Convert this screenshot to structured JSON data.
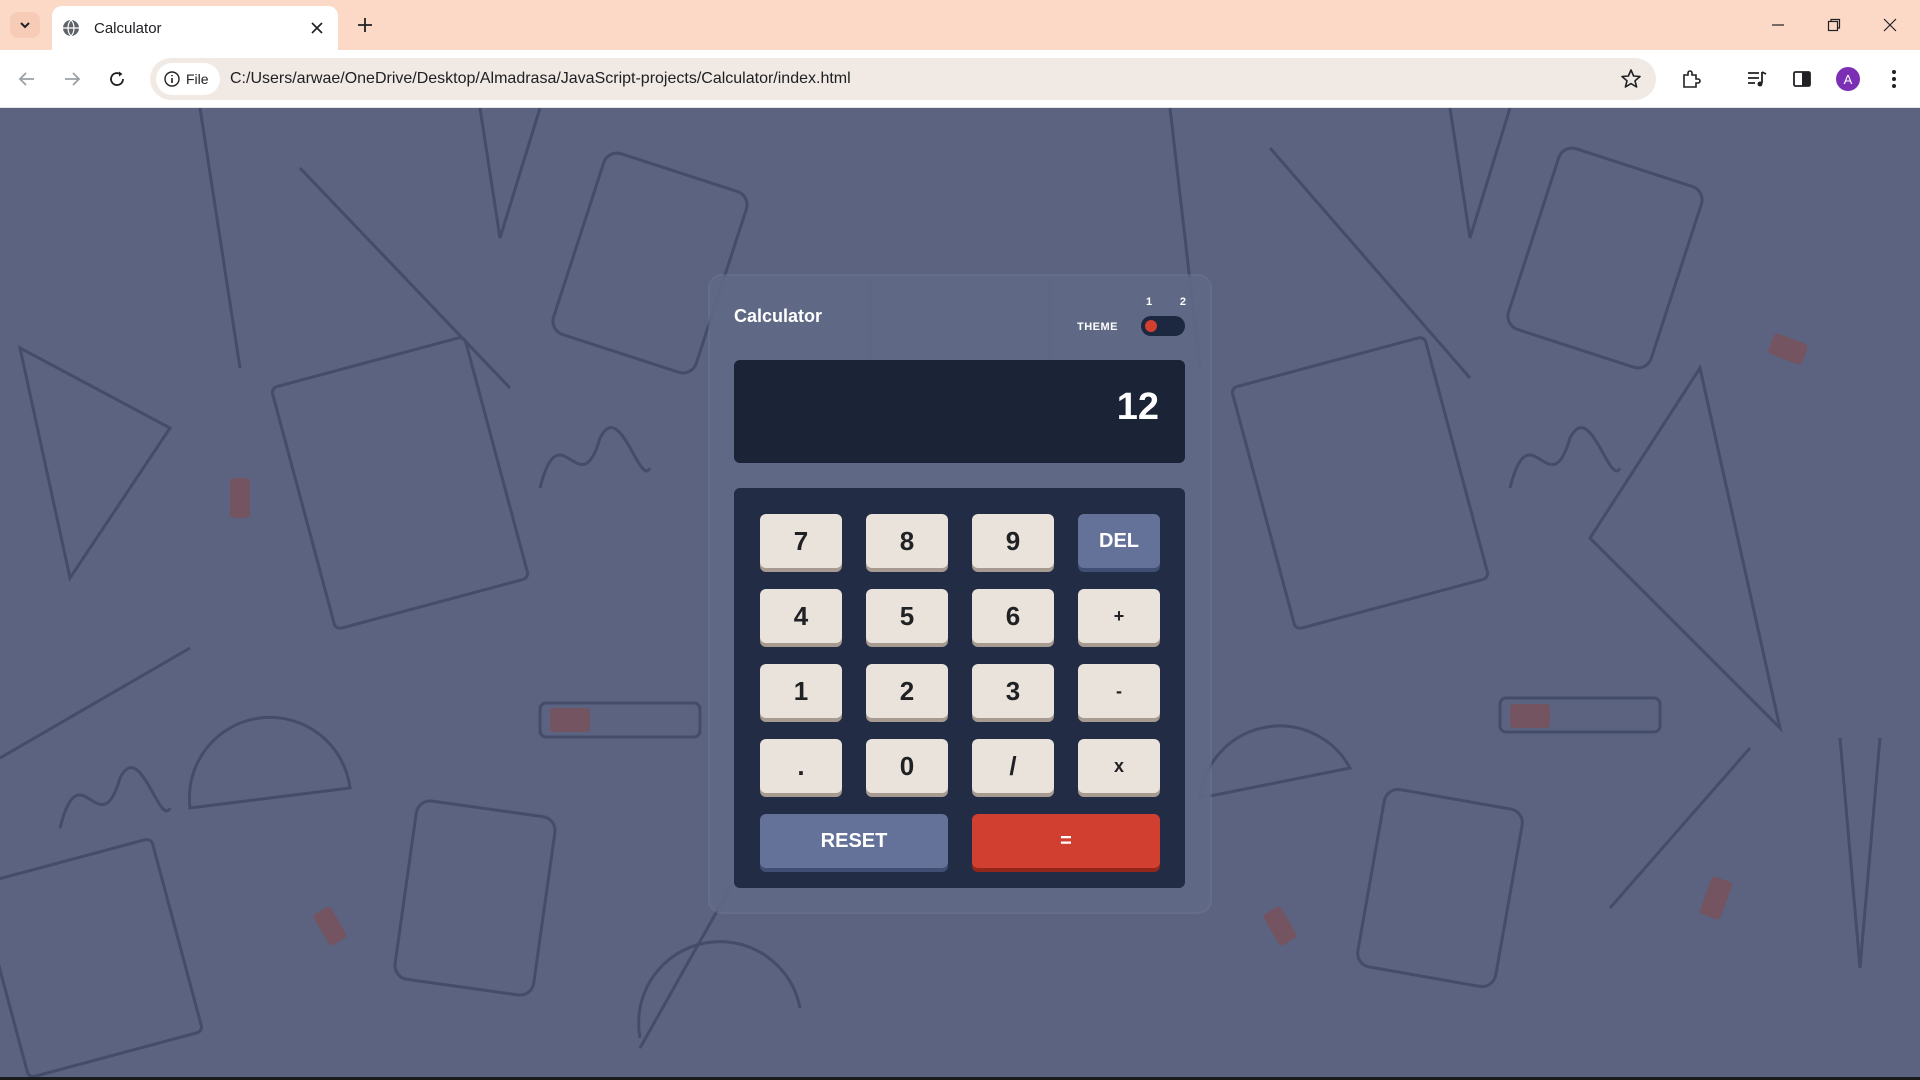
{
  "browser": {
    "tab_title": "Calculator",
    "url_chip": "File",
    "url": "C:/Users/arwae/OneDrive/Desktop/Almadrasa/JavaScript-projects/Calculator/index.html",
    "profile_initial": "A",
    "colors": {
      "tabbar": "#fbd9c6",
      "profile": "#7b2fb5"
    }
  },
  "calculator": {
    "title": "Calculator",
    "theme_label": "THEME",
    "theme_options": [
      "1",
      "2"
    ],
    "display_value": "12",
    "keys": {
      "seven": "7",
      "eight": "8",
      "nine": "9",
      "del": "DEL",
      "four": "4",
      "five": "5",
      "six": "6",
      "plus": "+",
      "one": "1",
      "two": "2",
      "three": "3",
      "minus": "-",
      "dot": ".",
      "zero": "0",
      "divide": "/",
      "multiply": "x",
      "reset": "RESET",
      "equals": "="
    },
    "colors": {
      "screen": "#1b2337",
      "keypad": "#232c45",
      "key": "#e9e3dc",
      "key_blue": "#647299",
      "key_red": "#d13f30"
    }
  }
}
